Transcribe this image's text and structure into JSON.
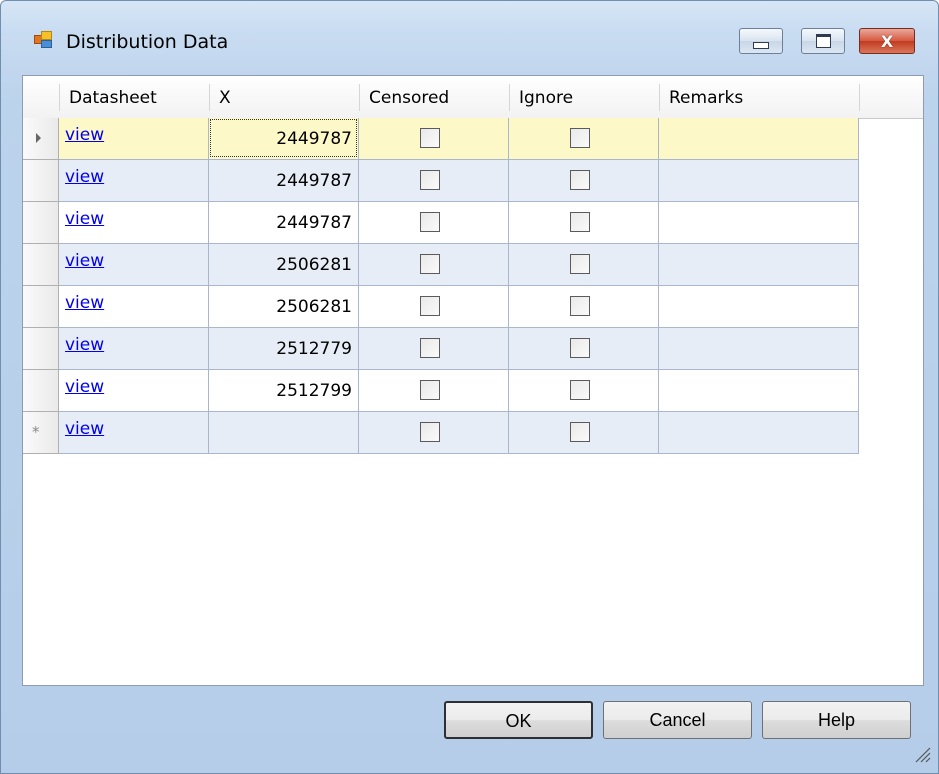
{
  "window": {
    "title": "Distribution Data",
    "close_label": "X"
  },
  "grid": {
    "columns": [
      "Datasheet",
      "X",
      "Censored",
      "Ignore",
      "Remarks"
    ],
    "rows": [
      {
        "datasheet": "view",
        "x": "2449787",
        "censored": false,
        "ignore": false,
        "remarks": "",
        "selected": true
      },
      {
        "datasheet": "view",
        "x": "2449787",
        "censored": false,
        "ignore": false,
        "remarks": ""
      },
      {
        "datasheet": "view",
        "x": "2449787",
        "censored": false,
        "ignore": false,
        "remarks": ""
      },
      {
        "datasheet": "view",
        "x": "2506281",
        "censored": false,
        "ignore": false,
        "remarks": ""
      },
      {
        "datasheet": "view",
        "x": "2506281",
        "censored": false,
        "ignore": false,
        "remarks": ""
      },
      {
        "datasheet": "view",
        "x": "2512779",
        "censored": false,
        "ignore": false,
        "remarks": ""
      },
      {
        "datasheet": "view",
        "x": "2512799",
        "censored": false,
        "ignore": false,
        "remarks": ""
      },
      {
        "datasheet": "view",
        "x": "",
        "censored": false,
        "ignore": false,
        "remarks": "",
        "new_row": true
      }
    ],
    "new_row_marker": "*"
  },
  "buttons": {
    "ok": "OK",
    "cancel": "Cancel",
    "help": "Help"
  },
  "colors": {
    "selected_row": "#fdf8c8",
    "alt_row": "#e6edf6",
    "link": "#0000ee"
  }
}
